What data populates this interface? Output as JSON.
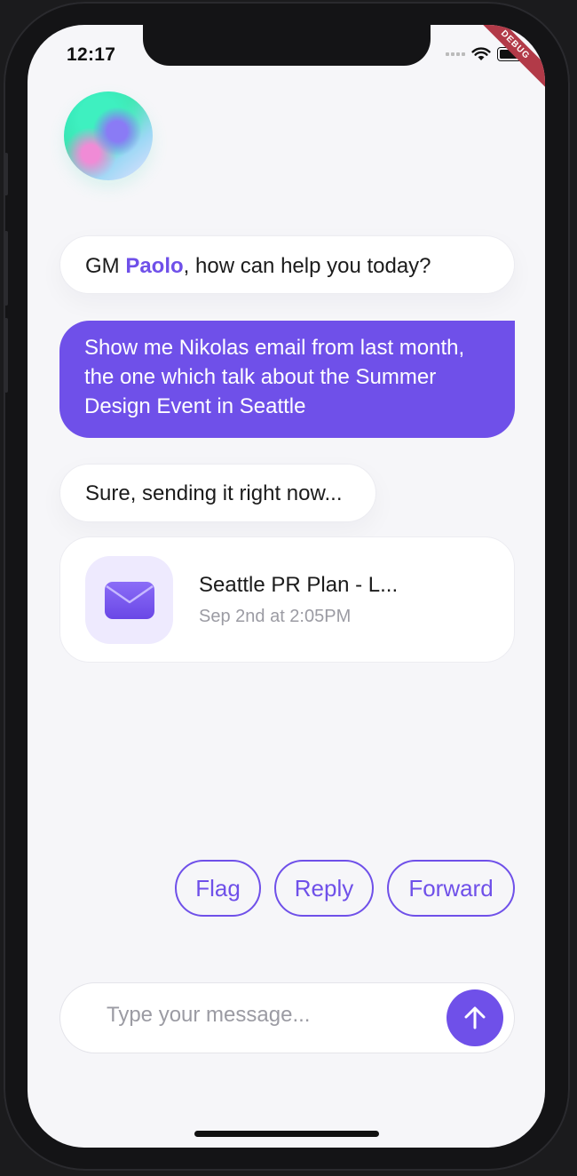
{
  "status_bar": {
    "time": "12:17",
    "debug_label": "DEBUG"
  },
  "messages": {
    "greeting_prefix": "GM ",
    "greeting_name": "Paolo",
    "greeting_suffix": ", how can help you today?",
    "user_request": "Show me Nikolas email from last month, the one which talk about the Summer Design Event in Seattle",
    "bot_reply": "Sure, sending it right now..."
  },
  "email_card": {
    "title": "Seattle PR Plan - L...",
    "time": "Sep 2nd at 2:05PM",
    "icon": "mail-icon"
  },
  "actions": {
    "flag": "Flag",
    "reply": "Reply",
    "forward": "Forward"
  },
  "composer": {
    "placeholder": "Type your message...",
    "send_icon": "arrow-up-icon"
  },
  "colors": {
    "accent": "#6f50e9",
    "background": "#f6f6f9",
    "bubble_bot": "#ffffff",
    "text_muted": "#9b9ba3"
  }
}
